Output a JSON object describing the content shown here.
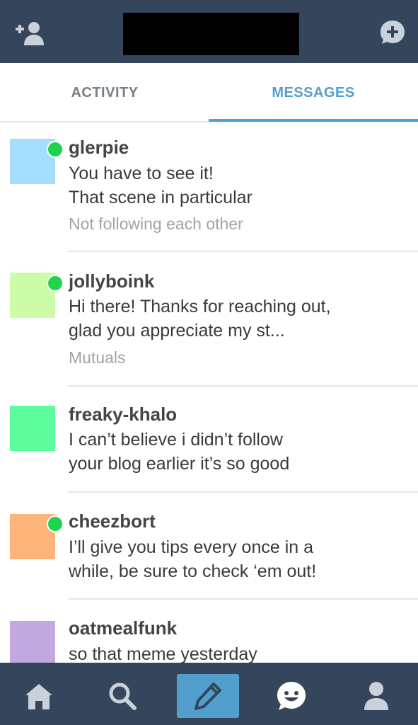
{
  "header": {
    "add_user_icon": "add-user-icon",
    "new_message_icon": "new-message-icon"
  },
  "tabs": {
    "activity": "ACTIVITY",
    "messages": "MESSAGES"
  },
  "messages": [
    {
      "username": "glerpie",
      "preview_lines": [
        "You have to see it!",
        "That scene in particular"
      ],
      "status": "Not following each other",
      "avatar_color": "#a4deff",
      "online": true
    },
    {
      "username": "jollyboink",
      "preview_lines": [
        "Hi there! Thanks for reaching out,",
        "glad you appreciate my st..."
      ],
      "status": "Mutuals",
      "avatar_color": "#cdfca8",
      "online": true
    },
    {
      "username": "freaky-khalo",
      "preview_lines": [
        "I can’t believe i didn’t follow",
        "your blog earlier it’s so good"
      ],
      "status": "",
      "avatar_color": "#5dfc9d",
      "online": false
    },
    {
      "username": "cheezbort",
      "preview_lines": [
        "I’ll give you tips every once in a",
        "while, be sure to check ‘em out!"
      ],
      "status": "",
      "avatar_color": "#fdb379",
      "online": true
    },
    {
      "username": "oatmealfunk",
      "preview_lines": [
        "so that meme yesterday"
      ],
      "status": "",
      "avatar_color": "#c1a9e0",
      "online": false
    }
  ],
  "bottom_nav": {
    "items": [
      "home-icon",
      "search-icon",
      "compose-icon",
      "messaging-icon",
      "account-icon"
    ]
  },
  "colors": {
    "header_bg": "#35465c",
    "accent": "#529ecc",
    "online": "#1ed44c"
  }
}
